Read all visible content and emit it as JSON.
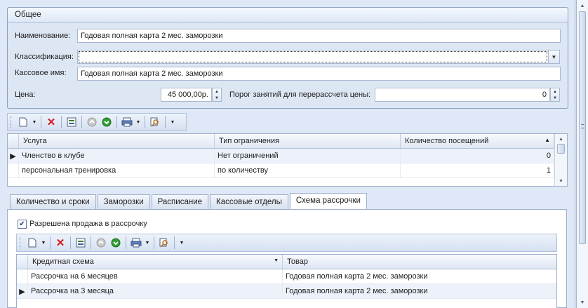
{
  "general": {
    "group_title": "Общее",
    "name_label": "Наименование:",
    "name_value": "Годовая полная карта 2 мес. заморозки",
    "classification_label": "Классификация:",
    "classification_value": "",
    "cash_name_label": "Кассовое имя:",
    "cash_name_value": "Годовая полная карта 2 мес. заморозки",
    "price_label": "Цена:",
    "price_value": "45 000,00р.",
    "threshold_label": "Порог занятий для перерассчета цены:",
    "threshold_value": "0"
  },
  "services_grid": {
    "columns": [
      "Услуга",
      "Тип ограничения",
      "Количество посещений"
    ],
    "rows": [
      {
        "service": "Членство в клубе",
        "restriction": "Нет ограничений",
        "visits": "0"
      },
      {
        "service": "персональная тренировка",
        "restriction": "по количеству",
        "visits": "1"
      }
    ]
  },
  "tabs": [
    "Количество и сроки",
    "Заморозки",
    "Расписание",
    "Кассовые отделы",
    "Схема рассрочки"
  ],
  "installment": {
    "checkbox_label": "Разрешена продажа в рассрочку",
    "checked": true,
    "columns": [
      "Кредитная схема",
      "Товар"
    ],
    "rows": [
      {
        "scheme": "Рассрочка на 6 месяцев",
        "product": "Годовая полная карта 2 мес. заморозки"
      },
      {
        "scheme": "Рассрочка на 3 месяца",
        "product": "Годовая полная карта 2 мес. заморозки"
      }
    ]
  },
  "colors": {
    "background": "#dfe8f6",
    "delete_red": "#d41a1a",
    "accent_green": "#2f9e2f"
  }
}
